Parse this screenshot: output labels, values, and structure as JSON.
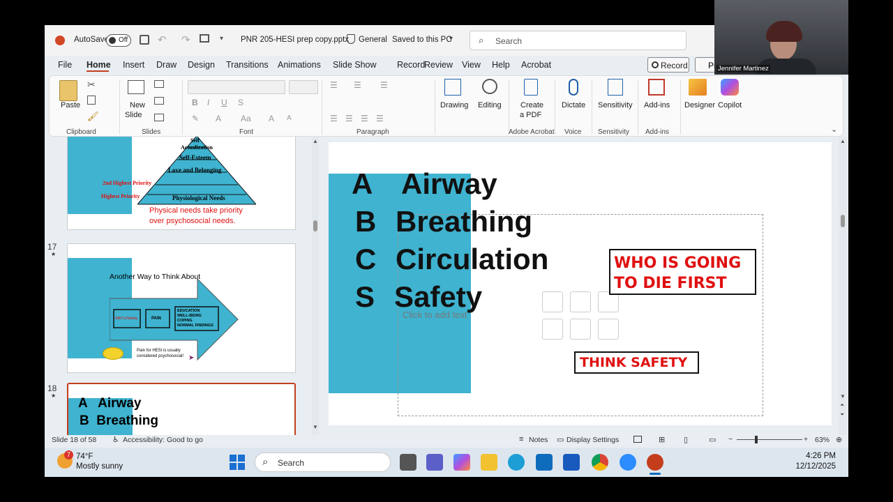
{
  "titlebar": {
    "autosave_label": "AutoSave",
    "autosave_state": "Off",
    "filename": "PNR 205-HESI prep copy.pptx",
    "sensitivity": "General",
    "saved_status": "Saved to this PC",
    "search_placeholder": "Search",
    "record_label": "Record",
    "present_label": "Pr"
  },
  "menu": [
    "File",
    "Home",
    "Insert",
    "Draw",
    "Design",
    "Transitions",
    "Animations",
    "Slide Show",
    "Record",
    "Review",
    "View",
    "Help",
    "Acrobat"
  ],
  "active_menu": "Home",
  "ribbon": {
    "paste": "Paste",
    "new_slide": "New",
    "new_slide2": "Slide",
    "groups": {
      "clipboard": "Clipboard",
      "slides": "Slides",
      "font": "Font",
      "paragraph": "Paragraph",
      "adobe": "Adobe Acrobat",
      "voice": "Voice",
      "sensitivity": "Sensitivity",
      "addins": "Add-ins"
    },
    "drawing": "Drawing",
    "editing": "Editing",
    "create_pdf": "Create",
    "create_pdf2": "a PDF",
    "dictate": "Dictate",
    "sensitivity_btn": "Sensitivity",
    "addins_btn": "Add-ins",
    "designer": "Designer",
    "copilot": "Copilot"
  },
  "thumbnails": {
    "slide16": {
      "levels": [
        "Self",
        "Actualization",
        "Self-Esteem",
        "Love and Belonging",
        "Physiological Needs"
      ],
      "second_priority": "2nd Highest Priority",
      "highest_priority": "Highest Priority",
      "note1": "Physical needs take priority",
      "note2": "over psychosocial needs."
    },
    "slide17": {
      "number": "17",
      "title": "Another Way to Think About",
      "box1": "ABC's/Safety",
      "box2": "PAIN",
      "box3": [
        "EDUCATION",
        "WELL-BEING",
        "COPING",
        "NORMAL FINDINGS"
      ],
      "pain_note1": "Pain for HESI is usually",
      "pain_note2": "considered psychosocial!"
    },
    "slide18": {
      "number": "18",
      "line1": "A   Airway",
      "line2": "B  Breathing"
    }
  },
  "slide": {
    "a": "A",
    "a_word": "Airway",
    "b": "B",
    "b_word": "Breathing",
    "c": "C",
    "c_word": "Circulation",
    "s": "S",
    "s_word": "Safety",
    "placeholder": "Click to add text",
    "who_line1": "WHO IS GOING",
    "who_line2": "TO DIE FIRST",
    "think_safety": "THINK SAFETY",
    "accent_color": "#3fb3cf",
    "alert_color": "#e01010"
  },
  "statusbar": {
    "slide_info": "Slide 18 of 58",
    "accessibility": "Accessibility: Good to go",
    "notes": "Notes",
    "display_settings": "Display Settings",
    "zoom": "63%",
    "zoom_level": 0.63
  },
  "webcam": {
    "name": "Jennifer Martinez"
  },
  "taskbar": {
    "temperature": "74°F",
    "weather": "Mostly sunny",
    "weather_badge": "7",
    "search_placeholder": "Search",
    "time": "4:26 PM",
    "date": "12/12/2025"
  }
}
